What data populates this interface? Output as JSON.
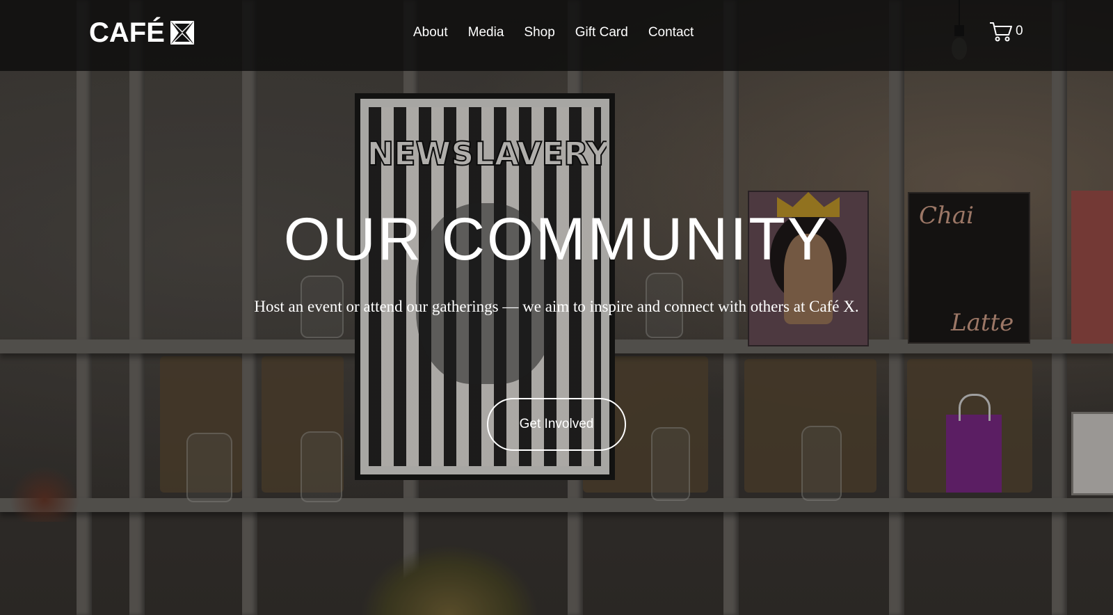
{
  "header": {
    "logo_text": "CAFÉ",
    "nav": [
      {
        "label": "About"
      },
      {
        "label": "Media"
      },
      {
        "label": "Shop"
      },
      {
        "label": "Gift Card"
      },
      {
        "label": "Contact"
      }
    ],
    "cart_count": "0",
    "cart_icon": "cart-icon"
  },
  "hero": {
    "title": "OUR COMMUNITY",
    "subtitle": "Host an event or attend our gatherings — we aim to inspire and connect with others at Café X.",
    "cta_label": "Get Involved"
  },
  "background": {
    "artwork_texts": [
      "NEWSLAVERY",
      "Chai",
      "Latte"
    ]
  },
  "colors": {
    "header_bg": "#0a0a0a",
    "text": "#ffffff"
  }
}
